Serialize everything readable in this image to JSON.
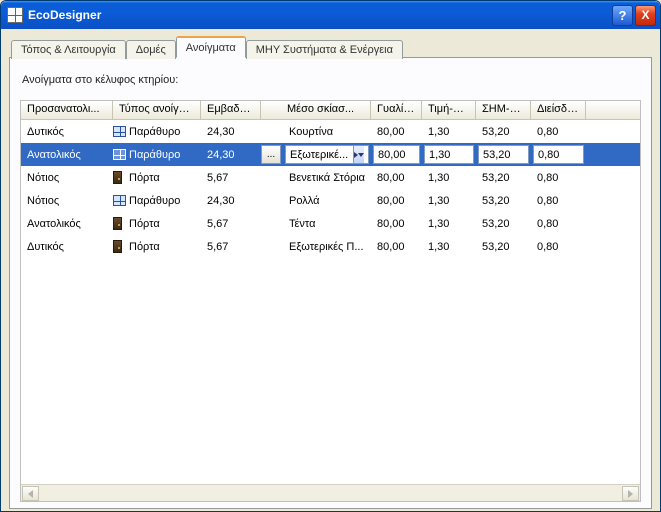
{
  "window": {
    "title": "EcoDesigner",
    "help_glyph": "?",
    "close_glyph": "X"
  },
  "tabs": [
    {
      "label": "Τόπος & Λειτουργία",
      "active": false
    },
    {
      "label": "Δομές",
      "active": false
    },
    {
      "label": "Ανοίγματα",
      "active": true
    },
    {
      "label": "MHY Συστήματα & Ενέργεια",
      "active": false
    }
  ],
  "panel": {
    "heading": "Ανοίγματα στο κέλυφος κτηρίου:"
  },
  "columns": {
    "c0": "Προσανατολι...",
    "c1": "Τύπος ανοίγμ...",
    "c2": "Εμβαδόν...",
    "c3": "Μέσο σκίασ...",
    "c4": "Γυαλί %",
    "c5": "Τιμή-U[...",
    "c6": "ΣΗΜ-TS...",
    "c7": "Διείσδυσ..."
  },
  "dots_label": "...",
  "rows": [
    {
      "orient": "Δυτικός",
      "type_icon": "window",
      "type": "Παράθυρο",
      "area": "24,30",
      "shade": "Κουρτίνα",
      "glass": "80,00",
      "u": "1,30",
      "shmts": "53,20",
      "inf": "0,80",
      "selected": false
    },
    {
      "orient": "Ανατολικός",
      "type_icon": "window",
      "type": "Παράθυρο",
      "area": "24,30",
      "shade": "Εξωτερικέ...",
      "glass": "80,00",
      "u": "1,30",
      "shmts": "53,20",
      "inf": "0,80",
      "selected": true,
      "editable": true
    },
    {
      "orient": "Νότιος",
      "type_icon": "door",
      "type": "Πόρτα",
      "area": "5,67",
      "shade": "Βενετικά Στόρια",
      "glass": "80,00",
      "u": "1,30",
      "shmts": "53,20",
      "inf": "0,80",
      "selected": false
    },
    {
      "orient": "Νότιος",
      "type_icon": "window",
      "type": "Παράθυρο",
      "area": "24,30",
      "shade": "Ρολλά",
      "glass": "80,00",
      "u": "1,30",
      "shmts": "53,20",
      "inf": "0,80",
      "selected": false
    },
    {
      "orient": "Ανατολικός",
      "type_icon": "door",
      "type": "Πόρτα",
      "area": "5,67",
      "shade": "Τέντα",
      "glass": "80,00",
      "u": "1,30",
      "shmts": "53,20",
      "inf": "0,80",
      "selected": false
    },
    {
      "orient": "Δυτικός",
      "type_icon": "door",
      "type": "Πόρτα",
      "area": "5,67",
      "shade": "Εξωτερικές Π...",
      "glass": "80,00",
      "u": "1,30",
      "shmts": "53,20",
      "inf": "0,80",
      "selected": false
    }
  ]
}
